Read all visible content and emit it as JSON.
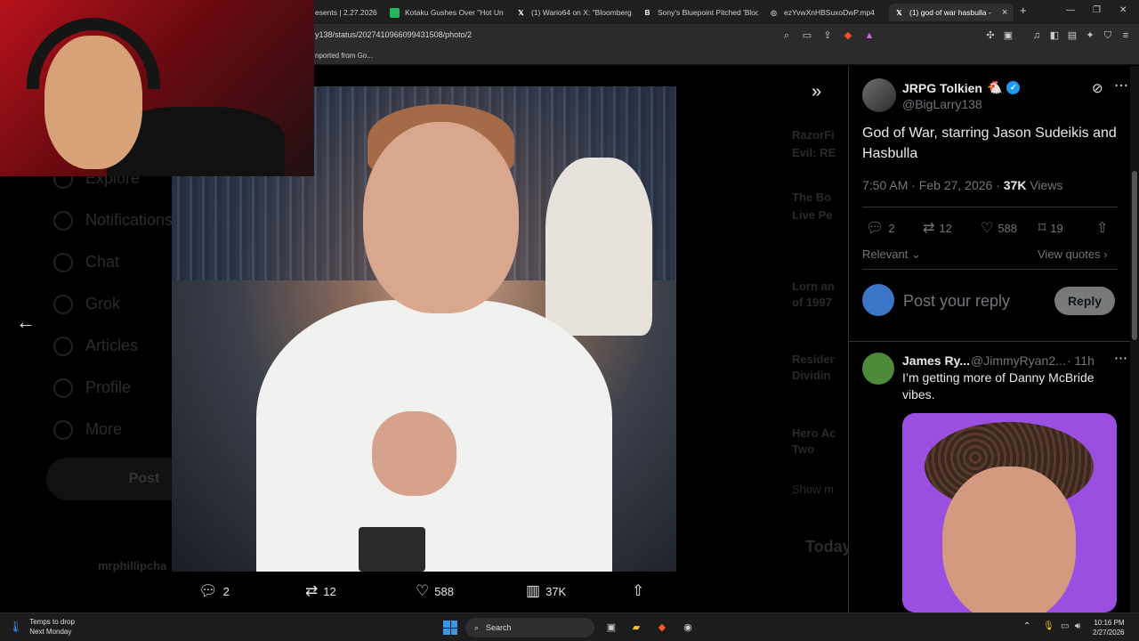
{
  "browser": {
    "tabs": [
      {
        "label": "esents | 2.27.2026",
        "favicon": "",
        "favicon_color": "#888888"
      },
      {
        "label": "Kotaku Gushes Over \"Hot Unck",
        "favicon": "▣",
        "favicon_color": "#20b95a"
      },
      {
        "label": "(1) Wario64 on X: \"Bloomberg:",
        "favicon": "𝕏",
        "favicon_color": "#ffffff"
      },
      {
        "label": "Sony's Bluepoint Pitched 'Bloo",
        "favicon": "B",
        "favicon_color": "#ffffff"
      },
      {
        "label": "ezYvwXnHBSuxoDwP.mp4",
        "favicon": "◎",
        "favicon_color": "#bbbbbb"
      },
      {
        "label": "(1) god of war hasbulla - S",
        "favicon": "𝕏",
        "favicon_color": "#ffffff"
      }
    ],
    "close_tab": "×",
    "new_tab": "+",
    "window_controls": [
      "—",
      "❐",
      "✕"
    ],
    "url": "y138/status/2027410966099431508/photo/2",
    "bookmark": "nported from Go..."
  },
  "left_nav_dimmed": [
    "Explore",
    "Notifications",
    "Chat",
    "Grok",
    "Articles",
    "Profile",
    "More"
  ],
  "left_post_button": "Post",
  "left_account_name": "mrphillipcha",
  "right_dimmed": [
    "RazorFi",
    "Evil: RE",
    "The Bo",
    "Live Pe",
    "Lorn an",
    "of 1997",
    "Resider",
    "Dividin",
    "Hero Ac",
    "Two",
    "Show m",
    "Today"
  ],
  "photo_viewer": {
    "back_icon": "←",
    "expand_icon": "»",
    "actions": {
      "replies": "2",
      "reposts": "12",
      "likes": "588",
      "views": "37K"
    }
  },
  "tweet": {
    "display_name": "JRPG Tolkien",
    "name_emoji": "🐔",
    "handle": "@BigLarry138",
    "text": "God of War, starring Jason Sudeikis and Hasbulla",
    "time": "7:50 AM · Feb 27, 2026 ·",
    "views_count": "37K",
    "views_label": "Views",
    "stats": {
      "replies": "2",
      "reposts": "12",
      "likes": "588",
      "bookmarks": "19"
    },
    "sort_label": "Relevant",
    "view_quotes": "View quotes"
  },
  "reply_composer": {
    "placeholder": "Post your reply",
    "button": "Reply"
  },
  "reply": {
    "display_name": "James Ry...",
    "handle": "@JimmyRyan2...",
    "time": "· 11h",
    "text": "I’m getting more of Danny McBride vibes."
  },
  "taskbar": {
    "weather_line1": "Temps to drop",
    "weather_line2": "Next Monday",
    "search_label": "Search",
    "time": "10:16 PM",
    "date": "2/27/2026"
  },
  "colors": {
    "accent": "#1d9bf0",
    "muted": "#71767b",
    "text": "#e7e9ea",
    "reply_button": "#787a7a"
  }
}
